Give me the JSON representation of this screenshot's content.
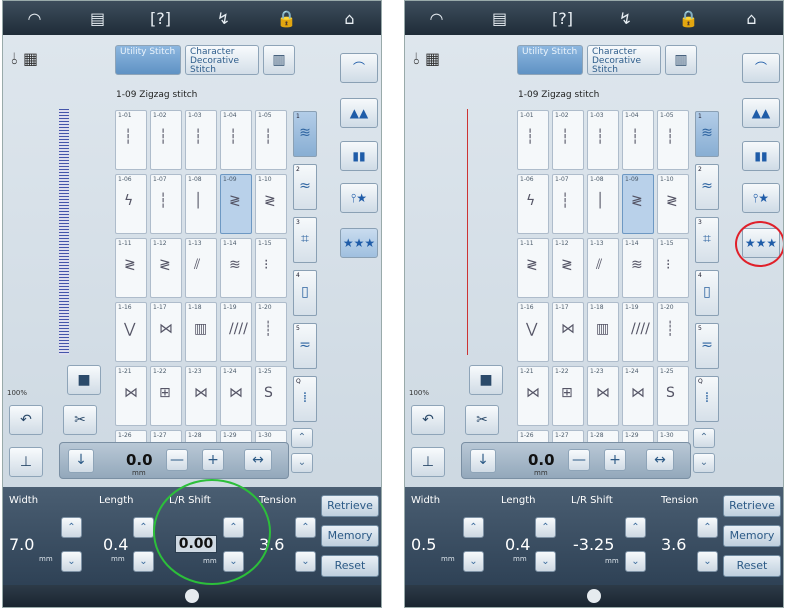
{
  "toolbar_icons": [
    "wifi-icon",
    "document-icon",
    "help-icon",
    "presser-foot-icon",
    "lock-icon",
    "home-icon"
  ],
  "toolbar_glyphs": [
    "◠",
    "▤",
    "[?]",
    "↯",
    "🔒",
    "⌂"
  ],
  "tabs": {
    "utility": "Utility Stitch",
    "character": "Character Decorative Stitch"
  },
  "pattern_name": "1-09 Zigzag stitch",
  "zoom": "100%",
  "stitches": {
    "codes": [
      "1-01",
      "1-02",
      "1-03",
      "1-04",
      "1-05",
      "1-06",
      "1-07",
      "1-08",
      "1-09",
      "1-10",
      "1-11",
      "1-12",
      "1-13",
      "1-14",
      "1-15",
      "1-16",
      "1-17",
      "1-18",
      "1-19",
      "1-20",
      "1-21",
      "1-22",
      "1-23",
      "1-24",
      "1-25",
      "1-26",
      "1-27",
      "1-28",
      "1-29",
      "1-30"
    ],
    "selected": "1-09",
    "glyphs": [
      "┆",
      "┆",
      "┆",
      "┆",
      "┆",
      "ϟ",
      "┆",
      "│",
      "≷",
      "≷",
      "≷",
      "≷",
      "⫽",
      "≋",
      "⁝",
      "⋁",
      "⋈",
      "▥",
      "////",
      "┊",
      "⋈",
      "⊞",
      "⋈",
      "⋈",
      "S",
      "~",
      "~",
      "~",
      "~",
      "~"
    ]
  },
  "categories": [
    {
      "n": "1",
      "g": "≋"
    },
    {
      "n": "2",
      "g": "≈"
    },
    {
      "n": "3",
      "g": "⌗"
    },
    {
      "n": "4",
      "g": "▯"
    },
    {
      "n": "5",
      "g": "≂"
    },
    {
      "n": "Q",
      "g": "⁞"
    }
  ],
  "strip": {
    "value": "0.0",
    "unit": "mm",
    "minus": "—",
    "plus": "+",
    "adjust": "↔"
  },
  "labels": {
    "width": "Width",
    "length": "Length",
    "lr_shift": "L/R Shift",
    "tension": "Tension",
    "retrieve": "Retrieve",
    "memory": "Memory",
    "reset": "Reset",
    "unit": "mm"
  },
  "left_screen": {
    "width": "7.0",
    "length": "0.4",
    "lr_shift": "0.00",
    "tension": "3.6"
  },
  "right_screen": {
    "width": "0.5",
    "length": "0.4",
    "lr_shift": "-3.25",
    "tension": "3.6"
  },
  "highlight_colors": {
    "green": "#2cbf3a",
    "red": "#e0202a"
  }
}
